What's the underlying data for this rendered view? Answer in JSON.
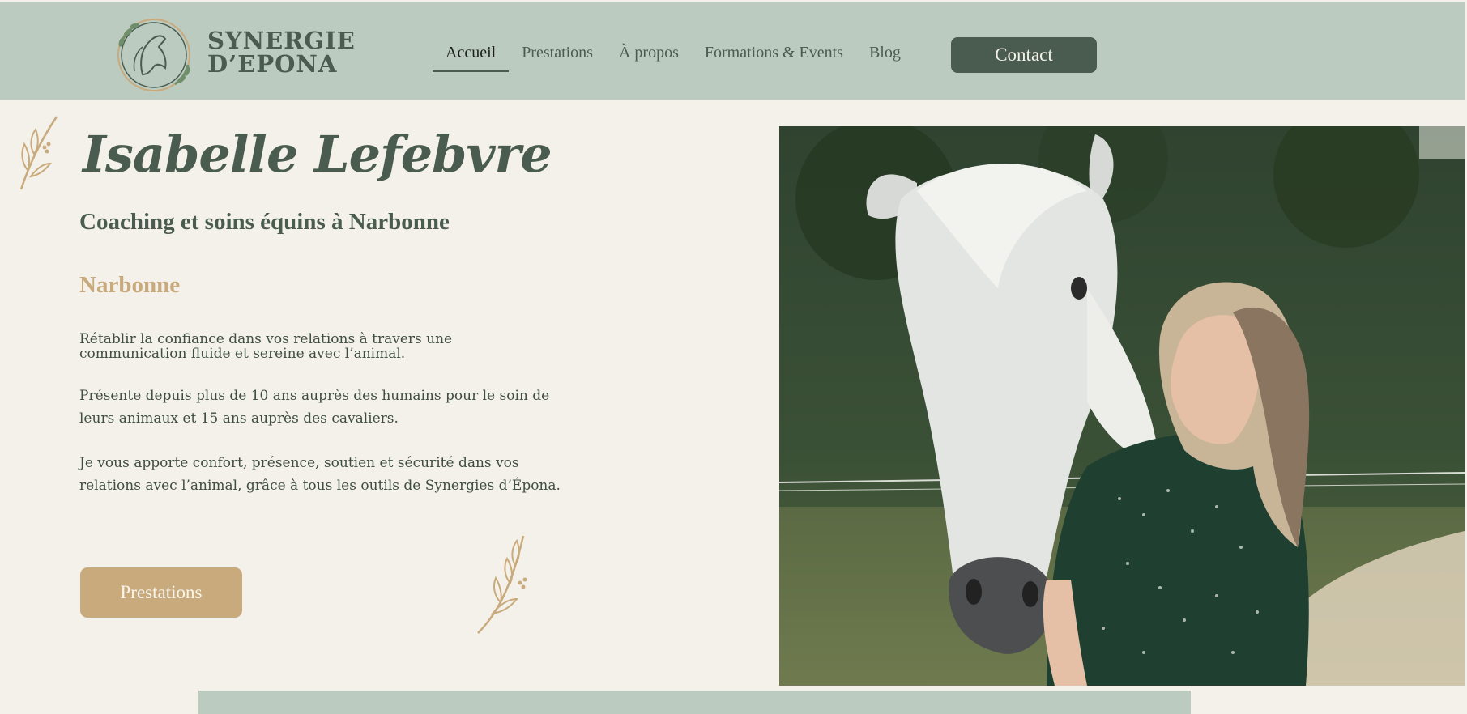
{
  "brand": {
    "line1": "SYNERGIE",
    "line2": "D’EPONA"
  },
  "nav": {
    "items": [
      "Accueil",
      "Prestations",
      "À propos",
      "Formations & Events",
      "Blog"
    ],
    "active": "Accueil",
    "contact_label": "Contact"
  },
  "hero": {
    "title": "Isabelle Lefebvre",
    "subtitle": "Coaching et soins équins à Narbonne",
    "city": "Narbonne",
    "paragraph1_line1": "Rétablir la confiance dans vos relations à travers une",
    "paragraph1_line2": "communication fluide et sereine avec l’animal.",
    "paragraph2": "Présente depuis plus de 10 ans auprès des humains pour le soin de leurs animaux et 15 ans auprès des cavaliers.",
    "paragraph3": "Je vous apporte confort, présence, soutien et sécurité dans vos relations avec l’animal, grâce à tous les outils de Synergies d’Épona.",
    "cta_label": "Prestations"
  },
  "colors": {
    "header_bg": "#bccbc0",
    "page_bg": "#f4f1ea",
    "dark_green": "#4a5c4f",
    "gold": "#c9aa7c"
  },
  "icons": {
    "logo": "horse-head-wreath-logo",
    "leaf": "olive-branch-icon"
  }
}
